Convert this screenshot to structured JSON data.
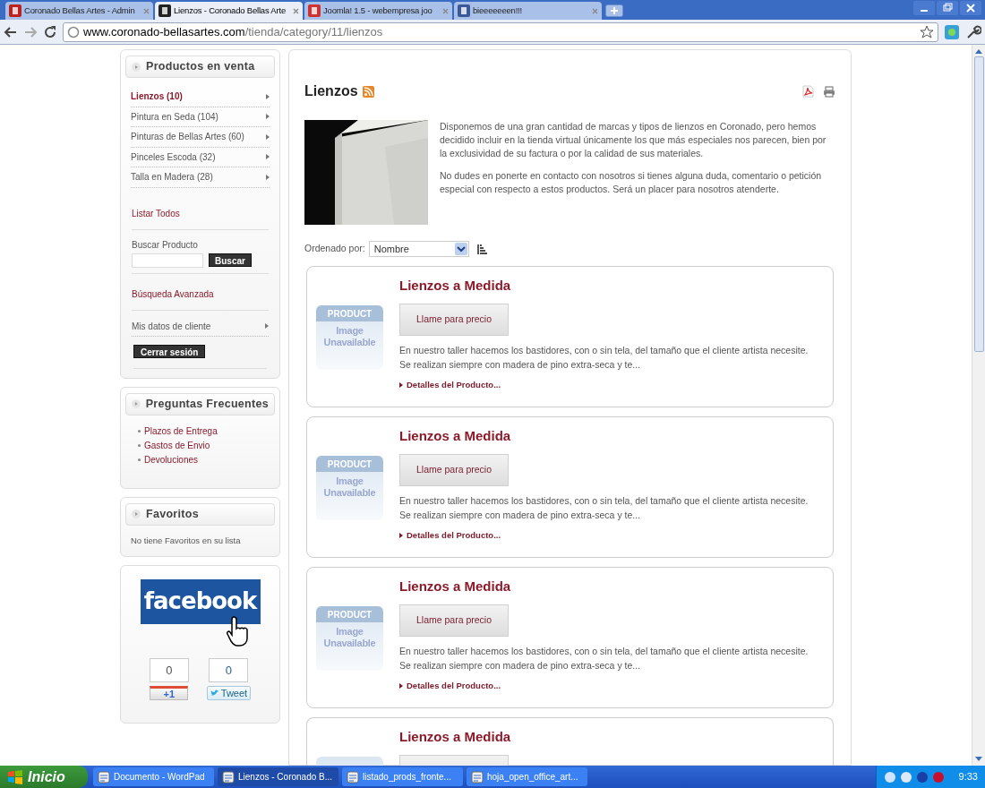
{
  "browser": {
    "tabs": [
      {
        "title": "Coronado Bellas Artes - Admin",
        "selected": false
      },
      {
        "title": "Lienzos - Coronado Bellas Arte",
        "selected": true
      },
      {
        "title": "Joomla! 1.5 - webempresa joo",
        "selected": false
      },
      {
        "title": "bieeeeeeen!!!",
        "selected": false
      }
    ],
    "url": {
      "host": "www.coronado-bellasartes.com",
      "path": "/tienda/category/11/lienzos"
    }
  },
  "sidebar": {
    "products_module": {
      "title": "Productos en venta",
      "categories": [
        {
          "label": "Lienzos (10)",
          "selected": true
        },
        {
          "label": "Pintura en Seda (104)",
          "selected": false
        },
        {
          "label": "Pinturas de Bellas Artes (60)",
          "selected": false
        },
        {
          "label": "Pinceles Escoda (32)",
          "selected": false
        },
        {
          "label": "Talla en Madera (28)",
          "selected": false
        }
      ],
      "list_all": "Listar Todos",
      "search_label": "Buscar Producto",
      "search_button": "Buscar",
      "advanced_search": "Búsqueda Avanzada",
      "account": "Mis datos de cliente",
      "logout": "Cerrar sesión"
    },
    "faq_module": {
      "title": "Preguntas Frecuentes",
      "links": [
        "Plazos de Entrega",
        "Gastos de Envio",
        "Devoluciones"
      ]
    },
    "favorites_module": {
      "title": "Favoritos",
      "message": "No tiene Favoritos en su lista"
    },
    "social_module": {
      "facebook": "facebook",
      "plusone_count": "0",
      "plusone_label": "+1",
      "tweet_count": "0",
      "tweet_label": "Tweet"
    }
  },
  "category": {
    "title": "Lienzos",
    "paragraphs": [
      "Disponemos de una gran cantidad de marcas y tipos de lienzos en Coronado, pero hemos decidido incluir en la tienda virtual únicamente los que más especiales nos parecen, bien por la exclusividad de su factura o por la calidad de sus materiales.",
      "No dudes en ponerte en contacto con nosotros si tienes alguna duda, comentario o petición especial con respecto a estos productos. Será un placer para nosotros atenderte."
    ],
    "sort_label": "Ordenado por:",
    "sort_value": "Nombre",
    "products": [
      {
        "kind": "full",
        "image_top": "PRODUCT",
        "image_text": "Image Unavailable",
        "name": "Lienzos a Medida",
        "price": "Llame para precio",
        "description": "En nuestro taller hacemos los bastidores, con o sin tela, del tamaño que el cliente artista necesite. Se realizan siempre con madera de pino extra-seca y te...",
        "details": "Detalles del Producto..."
      },
      {
        "kind": "full",
        "image_top": "PRODUCT",
        "image_text": "Image Unavailable",
        "name": "Lienzos a Medida",
        "price": "Llame para precio",
        "description": "En nuestro taller hacemos los bastidores, con o sin tela, del tamaño que el cliente artista necesite. Se realizan siempre con madera de pino extra-seca y te...",
        "details": "Detalles del Producto..."
      },
      {
        "kind": "full",
        "image_top": "PRODUCT",
        "image_text": "Image Unavailable",
        "name": "Lienzos a Medida",
        "price": "Llame para precio",
        "description": "En nuestro taller hacemos los bastidores, con o sin tela, del tamaño que el cliente artista necesite. Se realizan siempre con madera de pino extra-seca y te...",
        "details": "Detalles del Producto..."
      },
      {
        "kind": "partial",
        "name": "Lienzos a Medida"
      }
    ]
  },
  "taskbar": {
    "start": "Inicio",
    "buttons": [
      {
        "label": "Documento - WordPad",
        "selected": false
      },
      {
        "label": "Lienzos - Coronado B...",
        "selected": true
      },
      {
        "label": "listado_prods_fronte...",
        "selected": false
      },
      {
        "label": "hoja_open_office_art...",
        "selected": false
      }
    ],
    "clock": "9:33"
  }
}
